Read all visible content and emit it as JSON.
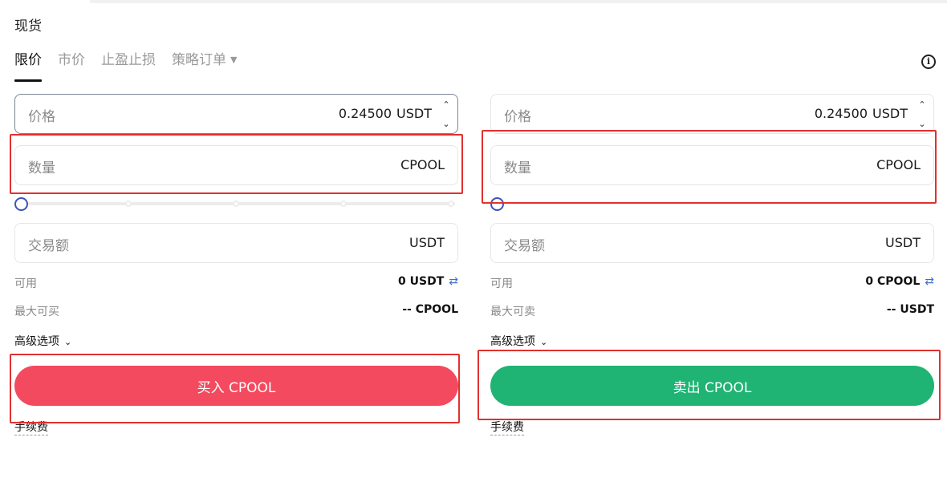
{
  "section_title": "现货",
  "tabs": [
    {
      "label": "限价",
      "active": true
    },
    {
      "label": "市价",
      "active": false
    },
    {
      "label": "止盈止损",
      "active": false
    },
    {
      "label": "策略订单",
      "active": false
    }
  ],
  "buy": {
    "price_label": "价格",
    "price_value": "0.24500",
    "price_unit": "USDT",
    "qty_label": "数量",
    "qty_unit": "CPOOL",
    "amount_label": "交易额",
    "amount_unit": "USDT",
    "available_label": "可用",
    "available_value": "0 USDT",
    "max_label": "最大可买",
    "max_value": "-- CPOOL",
    "advanced_label": "高级选项",
    "button_label": "买入 CPOOL",
    "fee_label": "手续费",
    "slider_percent": 0
  },
  "sell": {
    "price_label": "价格",
    "price_value": "0.24500",
    "price_unit": "USDT",
    "qty_label": "数量",
    "qty_unit": "CPOOL",
    "amount_label": "交易额",
    "amount_unit": "USDT",
    "available_label": "可用",
    "available_value": "0 CPOOL",
    "max_label": "最大可卖",
    "max_value": "-- USDT",
    "advanced_label": "高级选项",
    "button_label": "卖出 CPOOL",
    "fee_label": "手续费",
    "slider_percent": 0
  },
  "icons": {
    "info": "info-icon",
    "swap": "swap-arrows-icon",
    "caret": "caret-down-icon",
    "chevron": "chevron-down-icon"
  },
  "colors": {
    "buy_button": "#f34a5f",
    "sell_button": "#1fb374",
    "highlight": "#e0312f",
    "slider_handle": "#3b55b8"
  }
}
